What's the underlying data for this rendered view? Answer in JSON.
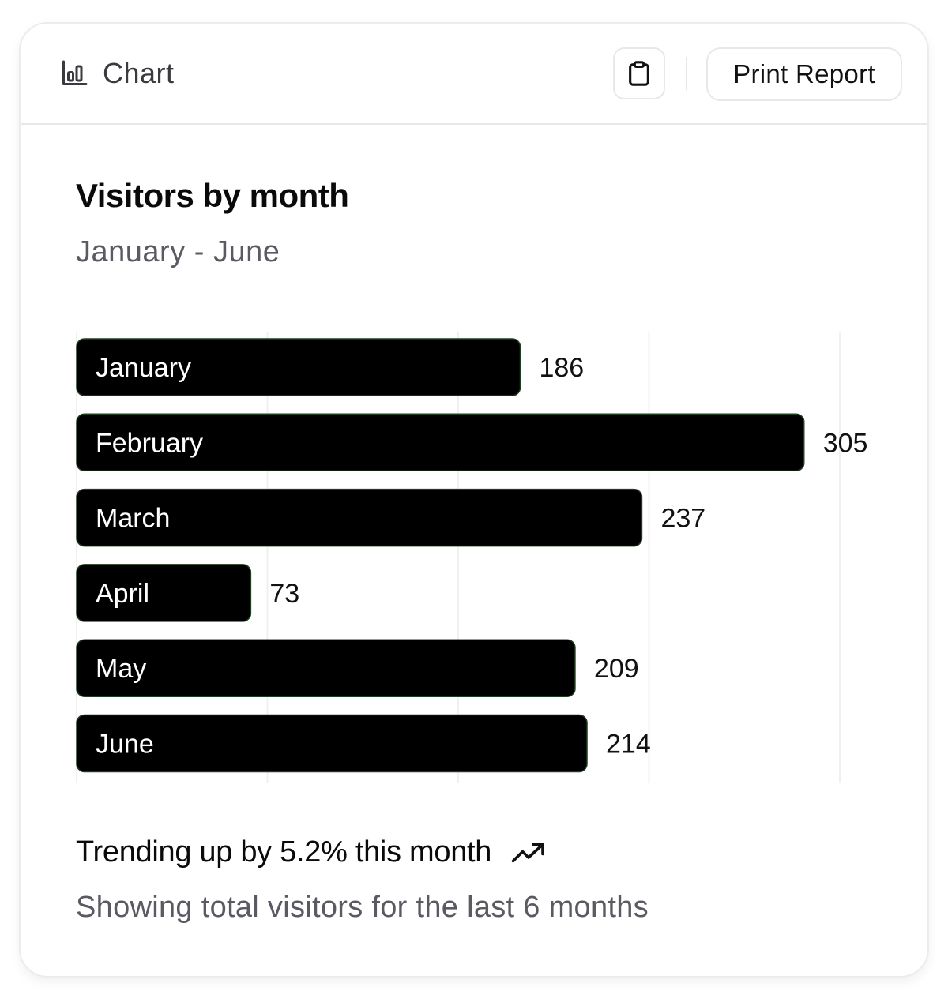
{
  "header": {
    "icon": "bar-chart-icon",
    "title": "Chart",
    "copy_button_icon": "clipboard-icon",
    "print_button_label": "Print Report"
  },
  "colors": {
    "bar_fill": "#000000",
    "bar_stroke": "#1f3d1f",
    "bar_label": "#ffffff",
    "grid": "#f0f0f0"
  },
  "footer": {
    "trend_text": "Trending up by 5.2% this month",
    "trend_icon": "trending-up-icon",
    "note": "Showing total visitors for the last 6 months"
  },
  "chart_data": {
    "type": "bar",
    "orientation": "horizontal",
    "title": "Visitors by month",
    "subtitle": "January - June",
    "categories": [
      "January",
      "February",
      "March",
      "April",
      "May",
      "June"
    ],
    "values": [
      186,
      305,
      237,
      73,
      209,
      214
    ],
    "xlabel": "",
    "ylabel": "",
    "xlim": [
      0,
      320
    ],
    "grid": true,
    "grid_step": 80,
    "labels_inside_bars": true,
    "value_labels": true,
    "legend": "none"
  }
}
